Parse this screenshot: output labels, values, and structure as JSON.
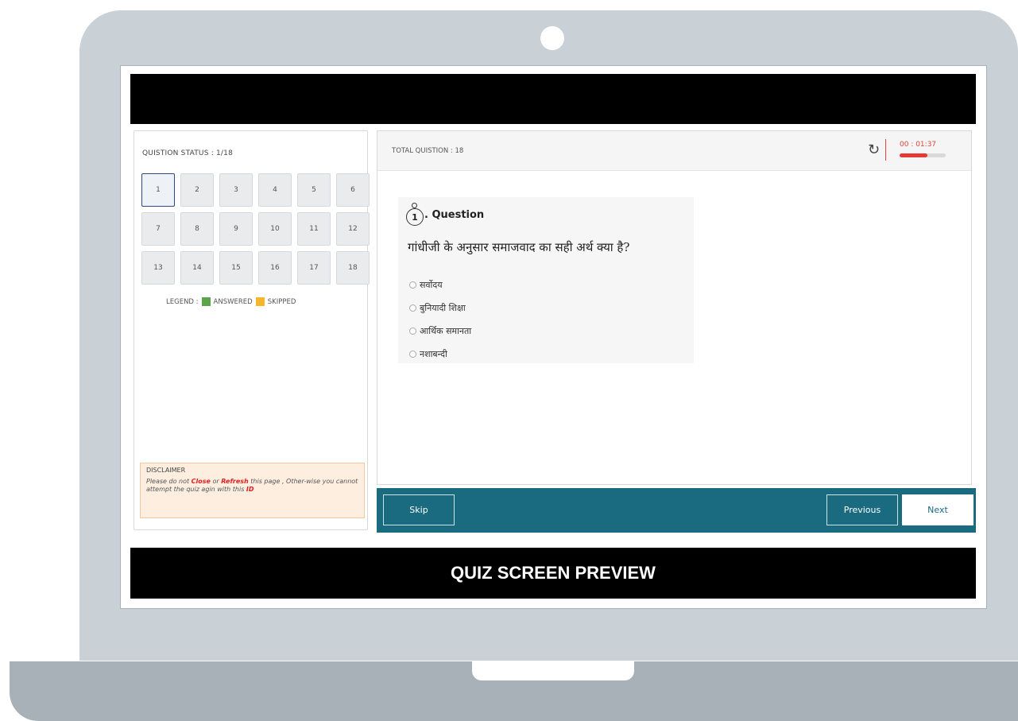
{
  "quiz": {
    "status_label": "QUISTION STATUS : 1/18",
    "question_numbers": [
      "1",
      "2",
      "3",
      "4",
      "5",
      "6",
      "7",
      "8",
      "9",
      "10",
      "11",
      "12",
      "13",
      "14",
      "15",
      "16",
      "17",
      "18"
    ],
    "current_question": 1,
    "legend": {
      "label": "LEGEND :",
      "answered_label": "ANSWERED",
      "skipped_label": "SKIPPED",
      "answered_color": "#5aa54a",
      "skipped_color": "#f7b52c"
    },
    "disclaimer": {
      "title": "DISCLAIMER",
      "text_1": "Please do not ",
      "close_word": "Close",
      "text_2": " or ",
      "refresh_word": "Refresh",
      "text_3": " this page , Other-wise you cannot attempt the quiz agin with this ",
      "id_word": "ID"
    },
    "total_questions_label": "TOTAL QUISTION : 18",
    "timer": {
      "icon": "timer-icon",
      "value": "00 : 01:37",
      "progress": 0.6,
      "color": "#e0443a"
    },
    "question": {
      "number": "1",
      "heading": ". Question",
      "text": "गांधीजी के अनुसार समाजवाद का सही अर्थ क्या है?",
      "options": [
        "सर्वोदय",
        "बुनियादी शिक्षा",
        "आर्थिक समानता",
        "नशाबन्दी"
      ]
    },
    "nav": {
      "skip": "Skip",
      "previous": "Previous",
      "next": "Next",
      "bar_color": "#1a6a80"
    }
  },
  "banner_title": "QUIZ SCREEN PREVIEW"
}
